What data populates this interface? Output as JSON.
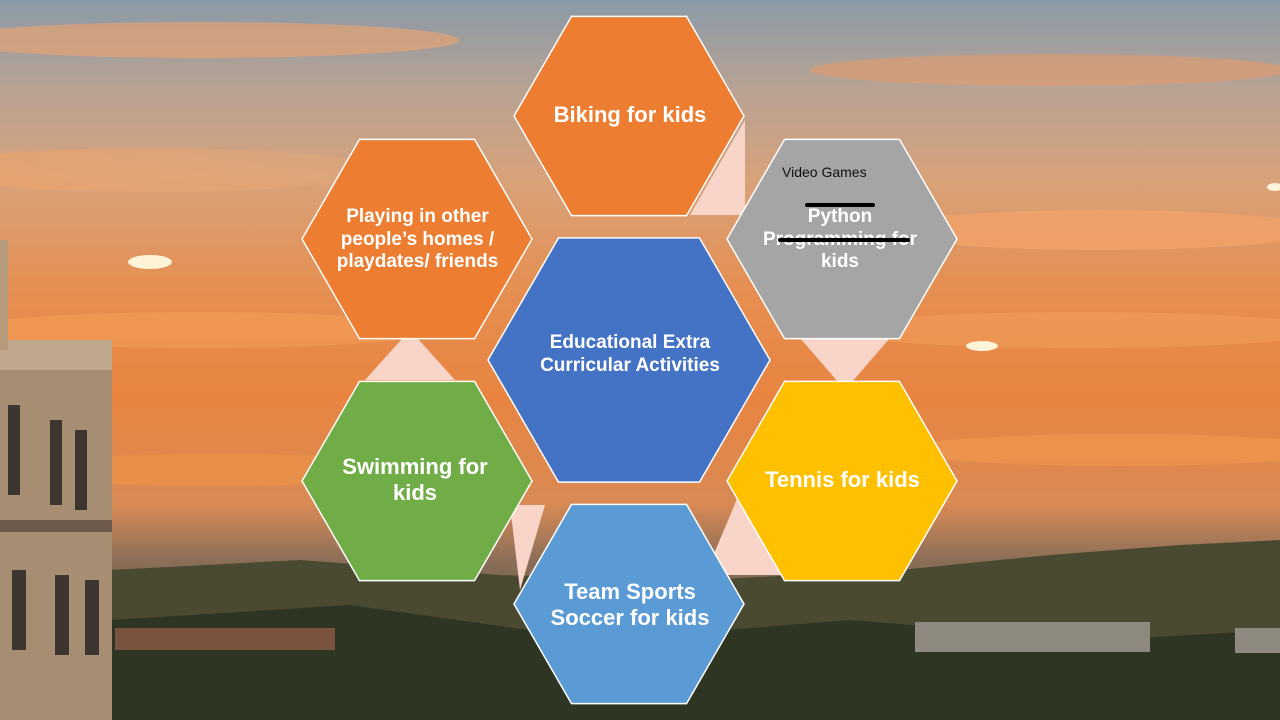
{
  "diagram": {
    "center": {
      "label": "Educational Extra Curricular Activities",
      "color": "#4472c4"
    },
    "nodes": [
      {
        "id": "biking",
        "label": "Biking for kids",
        "color": "#ed7d31"
      },
      {
        "id": "python",
        "label": "Python Programming for kids",
        "color": "#a5a5a5",
        "annotation": "Video Games",
        "struck_text": "Python Programming"
      },
      {
        "id": "tennis",
        "label": "Tennis for kids",
        "color": "#ffc000"
      },
      {
        "id": "team",
        "label": "Team Sports Soccer for kids",
        "color": "#5b9bd5"
      },
      {
        "id": "swimming",
        "label": "Swimming for kids",
        "color": "#70ad47"
      },
      {
        "id": "playing",
        "label": "Playing in other people’s homes / playdates/ friends",
        "color": "#ed7d31"
      }
    ],
    "connector_color": "#f8d5c8"
  }
}
